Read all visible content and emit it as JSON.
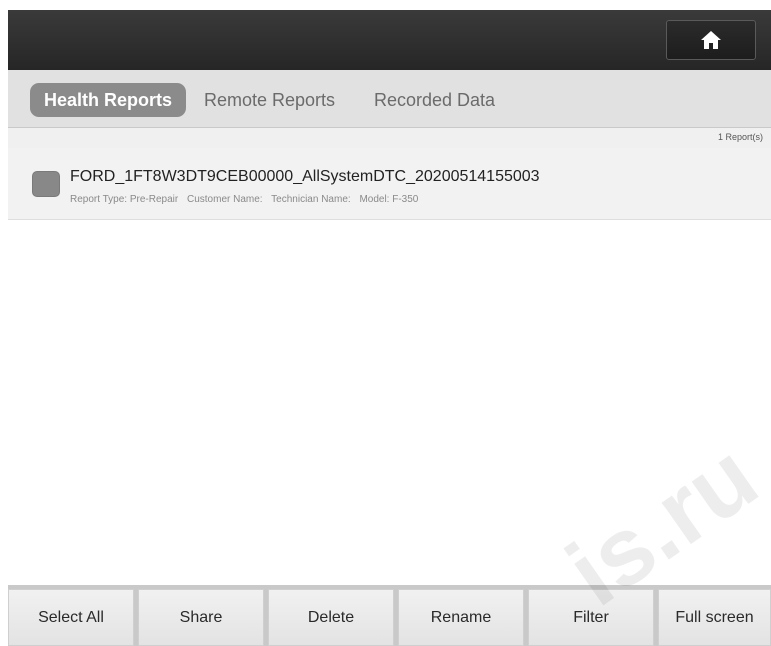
{
  "header": {
    "home_icon": "home-icon"
  },
  "tabs": [
    {
      "label": "Health Reports",
      "active": true
    },
    {
      "label": "Remote Reports",
      "active": false
    },
    {
      "label": "Recorded Data",
      "active": false
    }
  ],
  "report_count": "1 Report(s)",
  "reports": [
    {
      "title": "FORD_1FT8W3DT9CEB00000_AllSystemDTC_20200514155003",
      "report_type": "Report Type: Pre-Repair",
      "customer_name": "Customer Name:",
      "technician_name": "Technician Name:",
      "model": "Model: F-350",
      "checked": true
    }
  ],
  "toolbar": {
    "select_all": "Select All",
    "share": "Share",
    "delete": "Delete",
    "rename": "Rename",
    "filter": "Filter",
    "full_screen": "Full screen"
  },
  "watermark": "is.ru",
  "colors": {
    "topbar": "#2e2e2e",
    "active_tab": "#8b8b8b",
    "checkbox": "#888888"
  }
}
